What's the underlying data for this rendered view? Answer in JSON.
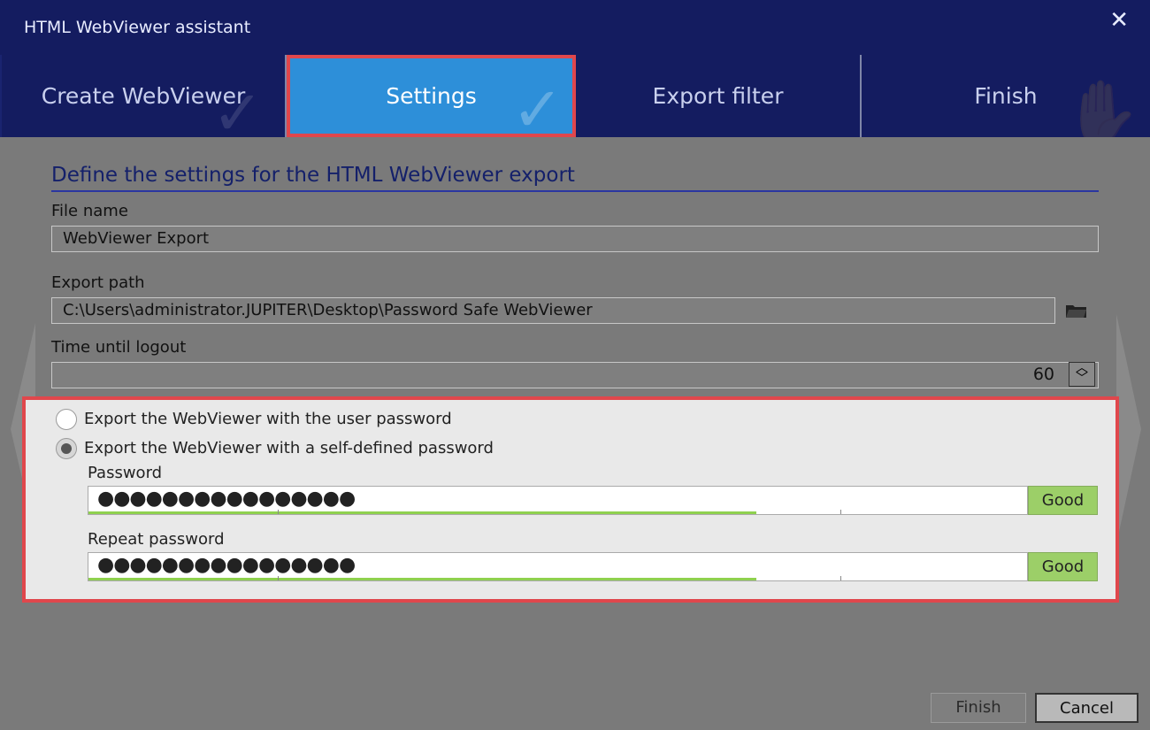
{
  "window": {
    "title": "HTML WebViewer assistant",
    "close_glyph": "✕"
  },
  "tabs": [
    {
      "label": "Create WebViewer",
      "active": false,
      "icon": "check-circle-icon"
    },
    {
      "label": "Settings",
      "active": true,
      "icon": "check-circle-icon"
    },
    {
      "label": "Export filter",
      "active": false,
      "icon": ""
    },
    {
      "label": "Finish",
      "active": false,
      "icon": "hand-stop-icon"
    }
  ],
  "settings": {
    "heading": "Define the settings for the HTML WebViewer export",
    "file_name_label": "File name",
    "file_name_value": "WebViewer Export",
    "export_path_label": "Export path",
    "export_path_value": "C:\\Users\\administrator.JUPITER\\Desktop\\Password Safe WebViewer",
    "logout_label": "Time until logout",
    "logout_value": "60"
  },
  "password_options": {
    "radio_user_password": "Export the WebViewer with the user password",
    "radio_self_defined": "Export the WebViewer with a self-defined password",
    "selected": "self_defined",
    "password_label": "Password",
    "password_mask": "●●●●●●●●●●●●●●●●",
    "password_strength": "Good",
    "repeat_label": "Repeat password",
    "repeat_mask": "●●●●●●●●●●●●●●●●",
    "repeat_strength": "Good"
  },
  "footer": {
    "finish_label": "Finish",
    "cancel_label": "Cancel"
  },
  "colors": {
    "title_bar": "#141c60",
    "active_tab": "#2d8fd9",
    "highlight": "#e0474c",
    "strength_good": "#9ccf68"
  }
}
